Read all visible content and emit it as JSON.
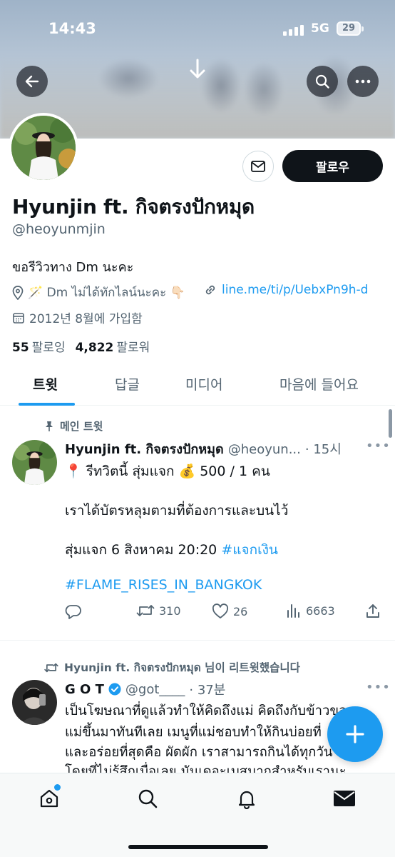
{
  "status_bar": {
    "time": "14:43",
    "network": "5G",
    "battery": "29"
  },
  "profile": {
    "name": "Hyunjin ft. กิจตรงปักหมุด",
    "handle": "@heoyunmjin",
    "bio": "ขอรีวิวทาง Dm นะคะ",
    "location": "🪄 Dm ไม่ได้ทักไลน์นะคะ 👇🏻",
    "link": "line.me/ti/p/UebxPn9h-d",
    "joined": "2012년 8월에 가입함",
    "following_count": "55",
    "following_label": "팔로잉",
    "followers_count": "4,822",
    "followers_label": "팔로워",
    "follow_button": "팔로우"
  },
  "tabs": [
    {
      "label": "트윗",
      "active": true
    },
    {
      "label": "답글",
      "active": false
    },
    {
      "label": "미디어",
      "active": false
    },
    {
      "label": "마음에 들어요",
      "active": false
    }
  ],
  "pinned_tweet": {
    "pin_label": "메인 트윗",
    "name": "Hyunjin ft. กิจตรงปักหมุด",
    "handle": "@heoyun...",
    "time": "· 15시",
    "lines": [
      "📍 รีทวิตนี้ สุ่มแจก 💰 500 / 1 คน",
      "เราได้บัตรหลุมตามที่ต้องการและบนไว้",
      "สุ่มแจก 6 สิงหาคม 20:20"
    ],
    "hashtag1": "#แจกเงิน",
    "hashtag2": "#FLAME_RISES_IN_BANGKOK",
    "reply_count": "",
    "retweets": "310",
    "likes": "26",
    "views": "6663"
  },
  "retweet": {
    "rt_label": "Hyunjin ft. กิจตรงปักหมุด 님이 리트윗했습니다",
    "name": "G O T",
    "handle": "@got____",
    "time": "· 37분",
    "lines": [
      "เป็นโฆษณาที่ดูแล้วทำให้คิดถึงแม่ คิดถึงกับข้าวของ",
      "แม่ขึ้นมาทันทีเลย เมนูที่แม่ชอบทำให้กินบ่อยที่",
      "และอร่อยที่สุดคือ ผัดผัก เราสามารถกินได้ทุกวัน",
      "โดยที่ไม่รู้สึกเบื่อเลย มันเดอะเบสมากสำหรับเรานะ"
    ]
  },
  "icons": {
    "back": "arrow-left-icon",
    "search": "search-icon",
    "more": "more-icon",
    "mail": "mail-icon",
    "compose": "plus-icon"
  },
  "colors": {
    "accent": "#1d9bf0",
    "text": "#0f1419",
    "muted": "#536471"
  }
}
